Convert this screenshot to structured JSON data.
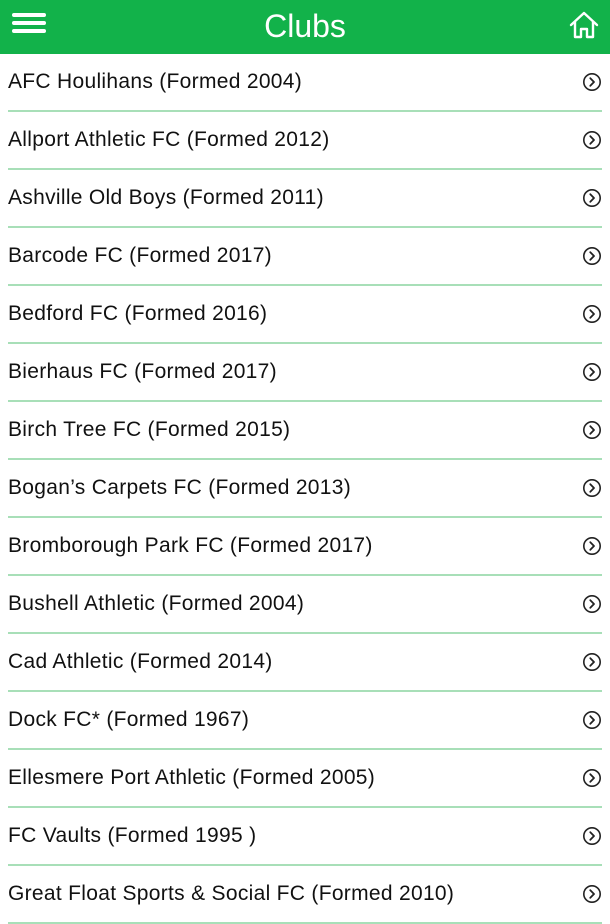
{
  "header": {
    "title": "Clubs",
    "menu_icon": "hamburger-menu-icon",
    "home_icon": "home-icon",
    "background_color": "#12b24a"
  },
  "clubs": [
    {
      "label": "AFC Houlihans (Formed 2004)"
    },
    {
      "label": "Allport Athletic FC (Formed 2012)"
    },
    {
      "label": "Ashville Old Boys (Formed 2011)"
    },
    {
      "label": "Barcode FC (Formed 2017)"
    },
    {
      "label": "Bedford FC (Formed 2016)"
    },
    {
      "label": "Bierhaus FC (Formed 2017)"
    },
    {
      "label": "Birch Tree FC (Formed 2015)"
    },
    {
      "label": "Bogan’s Carpets FC (Formed 2013)"
    },
    {
      "label": "Bromborough Park FC (Formed 2017)"
    },
    {
      "label": "Bushell Athletic (Formed 2004)"
    },
    {
      "label": "Cad Athletic (Formed 2014)"
    },
    {
      "label": "Dock FC* (Formed 1967)"
    },
    {
      "label": "Ellesmere Port Athletic (Formed 2005)"
    },
    {
      "label": "FC Vaults (Formed 1995 )"
    },
    {
      "label": "Great Float Sports & Social FC (Formed 2010)"
    }
  ],
  "row_icon": "chevron-circle-right-icon",
  "divider_color": "#a8dfb8"
}
